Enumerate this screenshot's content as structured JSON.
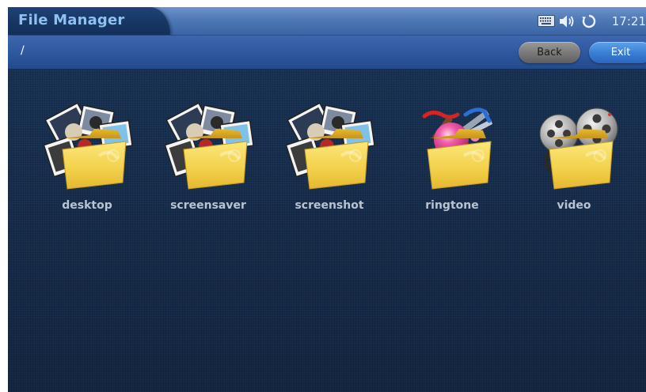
{
  "header": {
    "title": "File Manager",
    "status_icons": [
      "keyboard-icon",
      "speaker-icon",
      "sync-icon"
    ],
    "clock": "17:21"
  },
  "pathbar": {
    "path": "/",
    "back_label": "Back",
    "exit_label": "Exit"
  },
  "folders": [
    {
      "label": "desktop",
      "icon": "photos-folder-icon"
    },
    {
      "label": "screensaver",
      "icon": "photos-folder-icon"
    },
    {
      "label": "screenshot",
      "icon": "photos-folder-icon"
    },
    {
      "label": "ringtone",
      "icon": "music-folder-icon"
    },
    {
      "label": "video",
      "icon": "film-reel-folder-icon"
    }
  ],
  "colors": {
    "titlebar": "#4f78b6",
    "title_tab": "#173663",
    "title_text": "#8fc0f2",
    "pathbar": "#2f589f",
    "background": "#1c3557",
    "exit_button": "#3b80d6",
    "back_button": "#7a7a7a",
    "folder_yellow": "#f4d24a"
  }
}
